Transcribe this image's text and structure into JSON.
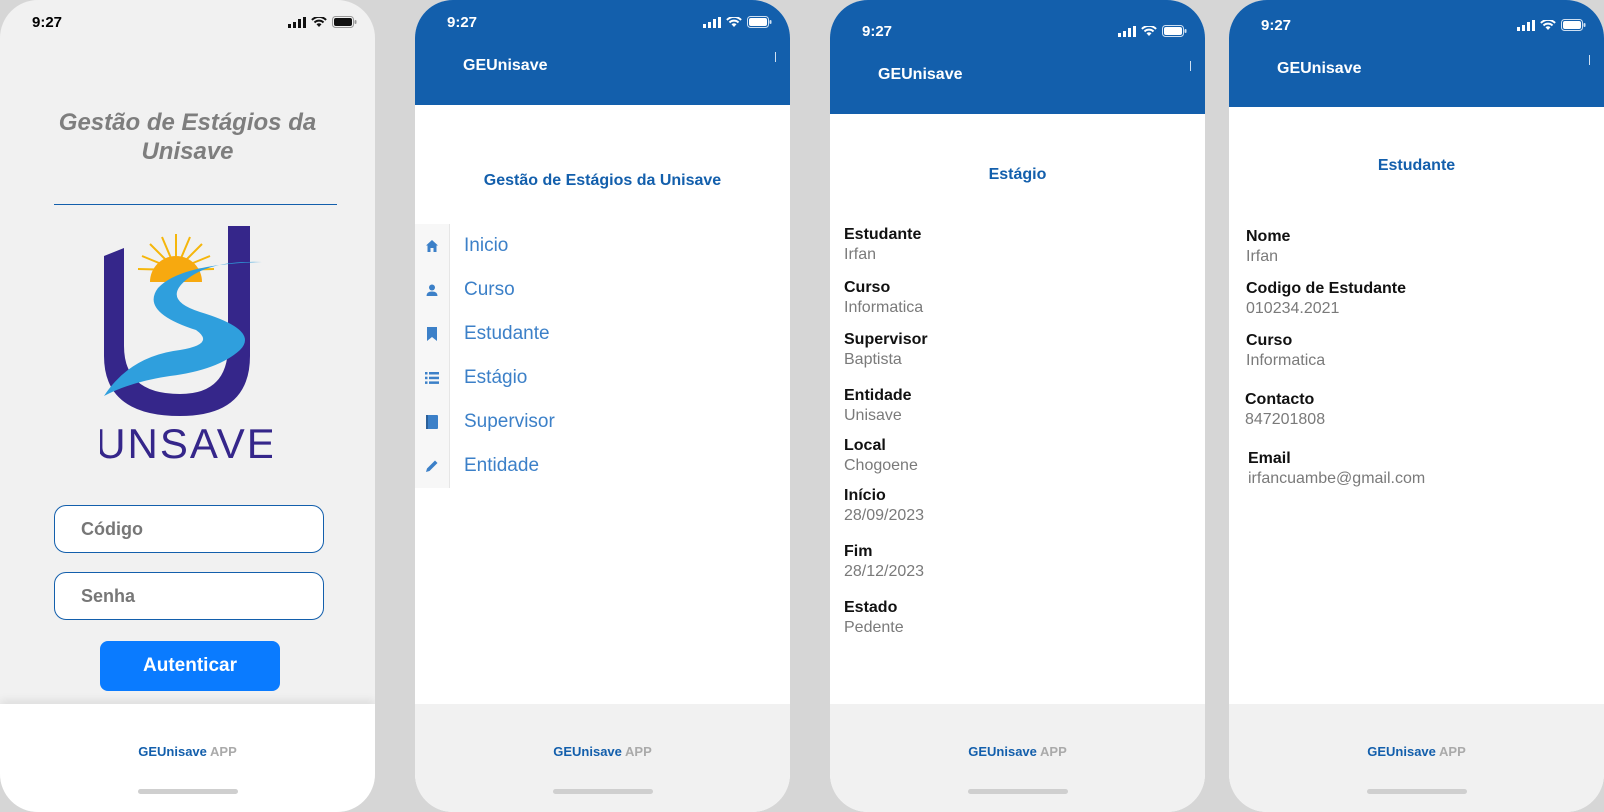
{
  "status_time": "9:27",
  "colors": {
    "primary": "#135fac",
    "button": "#0a7bff",
    "muted": "#7a7a7a"
  },
  "footer": {
    "brand_main": "GEUnisave",
    "brand_suffix": "APP"
  },
  "login": {
    "title": "Gestão de Estágios da Unisave",
    "logo_text": "UNSAVE",
    "code_placeholder": "Código",
    "password_placeholder": "Senha",
    "auth_label": "Autenticar"
  },
  "menu_screen": {
    "app_name": "GEUnisave",
    "heading": "Gestão de Estágios da Unisave",
    "items": [
      {
        "label": "Inicio",
        "icon": "home-icon"
      },
      {
        "label": "Curso",
        "icon": "person-icon"
      },
      {
        "label": "Estudante",
        "icon": "bookmark-icon"
      },
      {
        "label": "Estágio",
        "icon": "list-icon"
      },
      {
        "label": "Supervisor",
        "icon": "book-icon"
      },
      {
        "label": "Entidade",
        "icon": "pencil-icon"
      }
    ]
  },
  "estagio_screen": {
    "app_name": "GEUnisave",
    "heading": "Estágio",
    "fields": [
      {
        "label": "Estudante",
        "value": "Irfan"
      },
      {
        "label": "Curso",
        "value": "Informatica"
      },
      {
        "label": "Supervisor",
        "value": "Baptista"
      },
      {
        "label": "Entidade",
        "value": "Unisave"
      },
      {
        "label": "Local",
        "value": "Chogoene"
      },
      {
        "label": "Início",
        "value": "28/09/2023"
      },
      {
        "label": "Fim",
        "value": "28/12/2023"
      },
      {
        "label": "Estado",
        "value": "Pedente"
      }
    ]
  },
  "estudante_screen": {
    "app_name": "GEUnisave",
    "heading": "Estudante",
    "fields": [
      {
        "label": "Nome",
        "value": "Irfan"
      },
      {
        "label": "Codigo de Estudante",
        "value": "010234.2021"
      },
      {
        "label": "Curso",
        "value": "Informatica"
      },
      {
        "label": "Contacto",
        "value": "847201808"
      },
      {
        "label": "Email",
        "value": "irfancuambe@gmail.com"
      }
    ]
  }
}
